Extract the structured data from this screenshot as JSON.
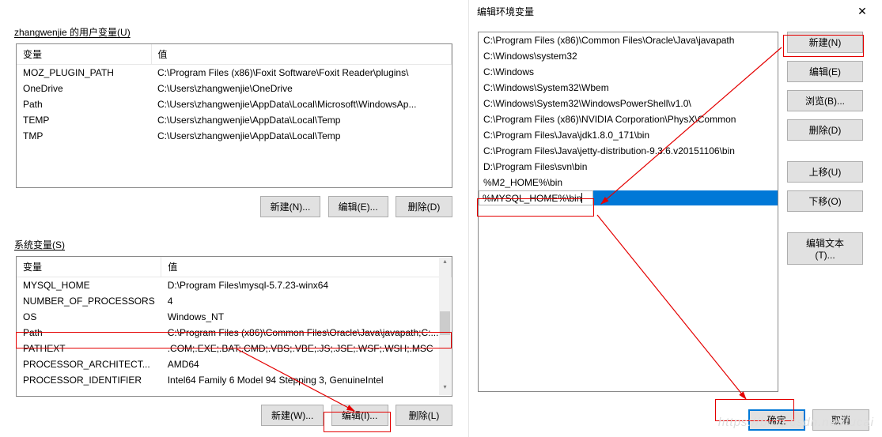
{
  "left": {
    "userLabel": "zhangwenjie 的用户变量(U)",
    "userHeaders": {
      "var": "变量",
      "val": "值"
    },
    "userVars": [
      {
        "name": "MOZ_PLUGIN_PATH",
        "value": "C:\\Program Files (x86)\\Foxit Software\\Foxit Reader\\plugins\\"
      },
      {
        "name": "OneDrive",
        "value": "C:\\Users\\zhangwenjie\\OneDrive"
      },
      {
        "name": "Path",
        "value": "C:\\Users\\zhangwenjie\\AppData\\Local\\Microsoft\\WindowsAp..."
      },
      {
        "name": "TEMP",
        "value": "C:\\Users\\zhangwenjie\\AppData\\Local\\Temp"
      },
      {
        "name": "TMP",
        "value": "C:\\Users\\zhangwenjie\\AppData\\Local\\Temp"
      }
    ],
    "userButtons": {
      "new": "新建(N)...",
      "edit": "编辑(E)...",
      "del": "删除(D)"
    },
    "sysLabel": "系统变量(S)",
    "sysHeaders": {
      "var": "变量",
      "val": "值"
    },
    "sysVars": [
      {
        "name": "MYSQL_HOME",
        "value": "D:\\Program Files\\mysql-5.7.23-winx64"
      },
      {
        "name": "NUMBER_OF_PROCESSORS",
        "value": "4"
      },
      {
        "name": "OS",
        "value": "Windows_NT"
      },
      {
        "name": "Path",
        "value": "C:\\Program Files (x86)\\Common Files\\Oracle\\Java\\javapath;C:..."
      },
      {
        "name": "PATHEXT",
        "value": ".COM;.EXE;.BAT;.CMD;.VBS;.VBE;.JS;.JSE;.WSF;.WSH;.MSC"
      },
      {
        "name": "PROCESSOR_ARCHITECT...",
        "value": "AMD64"
      },
      {
        "name": "PROCESSOR_IDENTIFIER",
        "value": "Intel64 Family 6 Model 94 Stepping 3, GenuineIntel"
      }
    ],
    "sysButtons": {
      "new": "新建(W)...",
      "edit": "编辑(I)...",
      "del": "删除(L)"
    }
  },
  "right": {
    "title": "编辑环境变量",
    "closeGlyph": "✕",
    "pathEntries": [
      "C:\\Program Files (x86)\\Common Files\\Oracle\\Java\\javapath",
      "C:\\Windows\\system32",
      "C:\\Windows",
      "C:\\Windows\\System32\\Wbem",
      "C:\\Windows\\System32\\WindowsPowerShell\\v1.0\\",
      "C:\\Program Files (x86)\\NVIDIA Corporation\\PhysX\\Common",
      "C:\\Program Files\\Java\\jdk1.8.0_171\\bin",
      "C:\\Program Files\\Java\\jetty-distribution-9.3.6.v20151106\\bin",
      "D:\\Program Files\\svn\\bin",
      "%M2_HOME%\\bin"
    ],
    "editingValue": "%MYSQL_HOME%\\bin",
    "buttons": {
      "new": "新建(N)",
      "edit": "编辑(E)",
      "browse": "浏览(B)...",
      "delete": "删除(D)",
      "up": "上移(U)",
      "down": "下移(O)",
      "editText": "编辑文本(T)..."
    },
    "ok": "确定",
    "cancel": "取消"
  },
  "watermark": "https://blog.csdn.net/fucai"
}
